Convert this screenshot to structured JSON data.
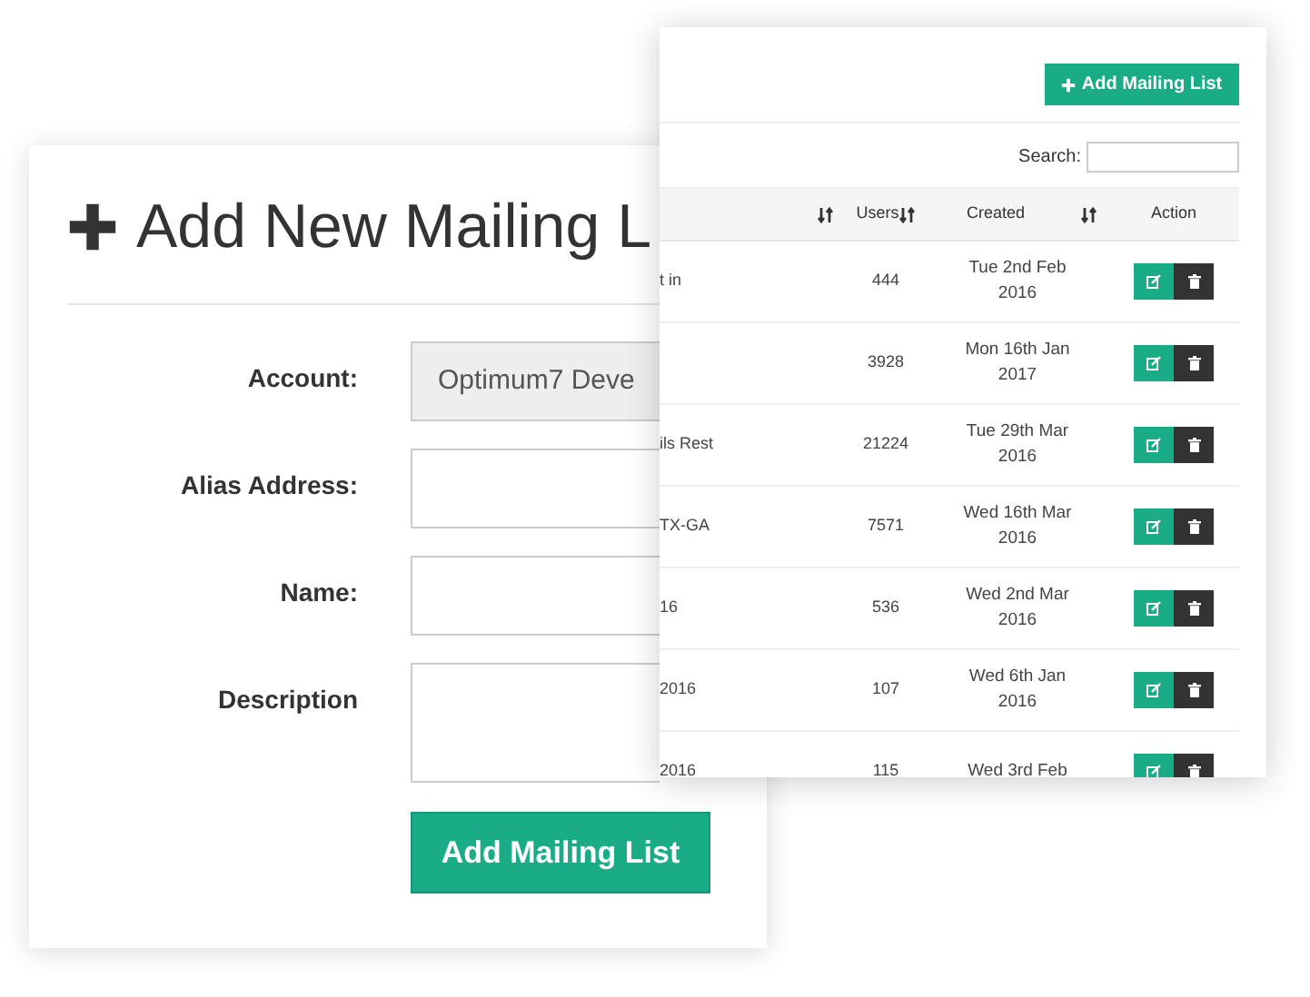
{
  "form_panel": {
    "title": "Add New Mailing L",
    "fields": [
      {
        "label": "Account:",
        "kind": "select",
        "value": "Optimum7 Deve"
      },
      {
        "label": "Alias Address:",
        "kind": "text"
      },
      {
        "label": "Name:",
        "kind": "text"
      },
      {
        "label": "Description",
        "kind": "textarea"
      }
    ],
    "submit_button": "Add Mailing List"
  },
  "list_panel": {
    "add_button": "Add Mailing List",
    "search": {
      "label": "Search:"
    },
    "table": {
      "columns": [
        {
          "sortable": true
        },
        {
          "label": "Users",
          "sortable": true
        },
        {
          "label": "Created",
          "sortable": true
        },
        {
          "label": "Action",
          "sortable": false
        }
      ],
      "rows": [
        {
          "name": "t in",
          "users": "444",
          "created": "Tue 2nd Feb 2016"
        },
        {
          "users": "3928",
          "created": "Mon 16th Jan 2017"
        },
        {
          "name": "ils Rest",
          "users": "21224",
          "created": "Tue 29th Mar 2016"
        },
        {
          "name": "TX-GA",
          "users": "7571",
          "created": "Wed 16th Mar 2016"
        },
        {
          "name": "16",
          "users": "536",
          "created": "Wed 2nd Mar 2016"
        },
        {
          "name": "2016",
          "users": "107",
          "created": "Wed 6th Jan 2016"
        },
        {
          "name": "2016",
          "users": "115",
          "created": "Wed 3rd Feb"
        }
      ]
    }
  }
}
